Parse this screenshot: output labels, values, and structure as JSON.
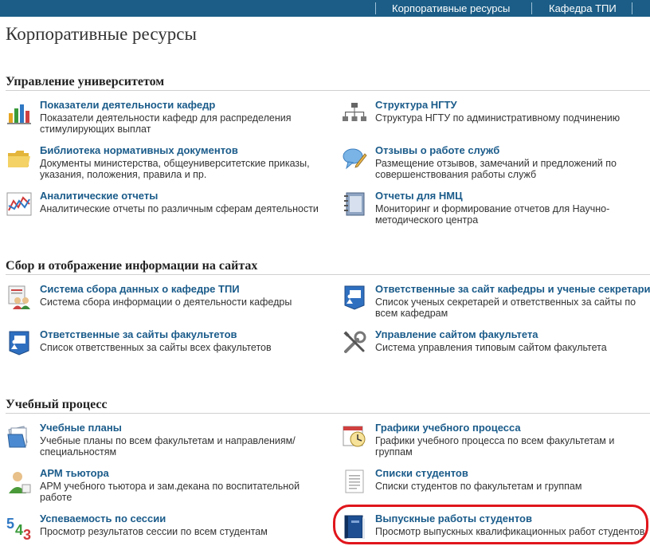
{
  "topnav": {
    "items": [
      "Корпоративные ресурсы",
      "Кафедра ТПИ"
    ]
  },
  "page_title": "Корпоративные ресурсы",
  "sections": [
    {
      "title": "Управление университетом",
      "items": [
        {
          "title": "Показатели деятельности кафедр",
          "desc": "Показатели деятельности кафедр для распределения стимулирующих выплат",
          "icon": "bar-chart-icon"
        },
        {
          "title": "Структура НГТУ",
          "desc": "Структура НГТУ по административному подчинению",
          "icon": "org-structure-icon"
        },
        {
          "title": "Библиотека нормативных документов",
          "desc": "Документы министерства, общеуниверситетские приказы, указания, положения, правила и пр.",
          "icon": "folder-icon"
        },
        {
          "title": "Отзывы о работе служб",
          "desc": "Размещение отзывов, замечаний и предложений по совершенствования работы служб",
          "icon": "speech-bubble-pencil-icon"
        },
        {
          "title": "Аналитические отчеты",
          "desc": "Аналитические отчеты по различным сферам деятельности",
          "icon": "line-chart-icon"
        },
        {
          "title": "Отчеты для НМЦ",
          "desc": "Мониторинг и формирование отчетов для Научно-методического центра",
          "icon": "notebook-icon"
        }
      ]
    },
    {
      "title": "Сбор и отображение информации на сайтах",
      "items": [
        {
          "title": "Система сбора данных о кафедре ТПИ",
          "desc": "Система сбора информации о деятельности кафедры",
          "icon": "users-report-icon"
        },
        {
          "title": "Ответственные за сайт кафедры и ученые секретари",
          "desc": "Список ученых секретарей и ответственных за сайты по всем кафедрам",
          "icon": "user-presentation-icon"
        },
        {
          "title": "Ответственные за сайты факультетов",
          "desc": "Список ответственных за сайты всех факультетов",
          "icon": "user-presentation-icon"
        },
        {
          "title": "Управление сайтом факультета",
          "desc": "Система управления типовым сайтом факультета",
          "icon": "tools-icon"
        }
      ]
    },
    {
      "title": "Учебный процесс",
      "items": [
        {
          "title": "Учебные планы",
          "desc": "Учебные планы по всем факультетам и направлениям/специальностям",
          "icon": "document-stack-icon"
        },
        {
          "title": "Графики учебного процесса",
          "desc": "Графики учебного процесса по всем факультетам и группам",
          "icon": "calendar-clock-icon"
        },
        {
          "title": "АРМ тьютора",
          "desc": "АРМ учебного тьютора и зам.декана по воспитательной работе",
          "icon": "tutor-user-icon"
        },
        {
          "title": "Списки студентов",
          "desc": "Списки студентов по факультетам и группам",
          "icon": "list-document-icon"
        },
        {
          "title": "Успеваемость по сессии",
          "desc": "Просмотр результатов сессии по всем студентам",
          "icon": "grades-543-icon",
          "glyphs": [
            "5",
            "4",
            "3"
          ]
        },
        {
          "title": "Выпускные работы студентов",
          "desc": "Просмотр выпускных квалификационных работ студентов",
          "icon": "book-icon"
        }
      ]
    }
  ],
  "colors": {
    "topbar": "#1b5d86",
    "link": "#1a5b8a",
    "highlight": "#e0161c"
  }
}
